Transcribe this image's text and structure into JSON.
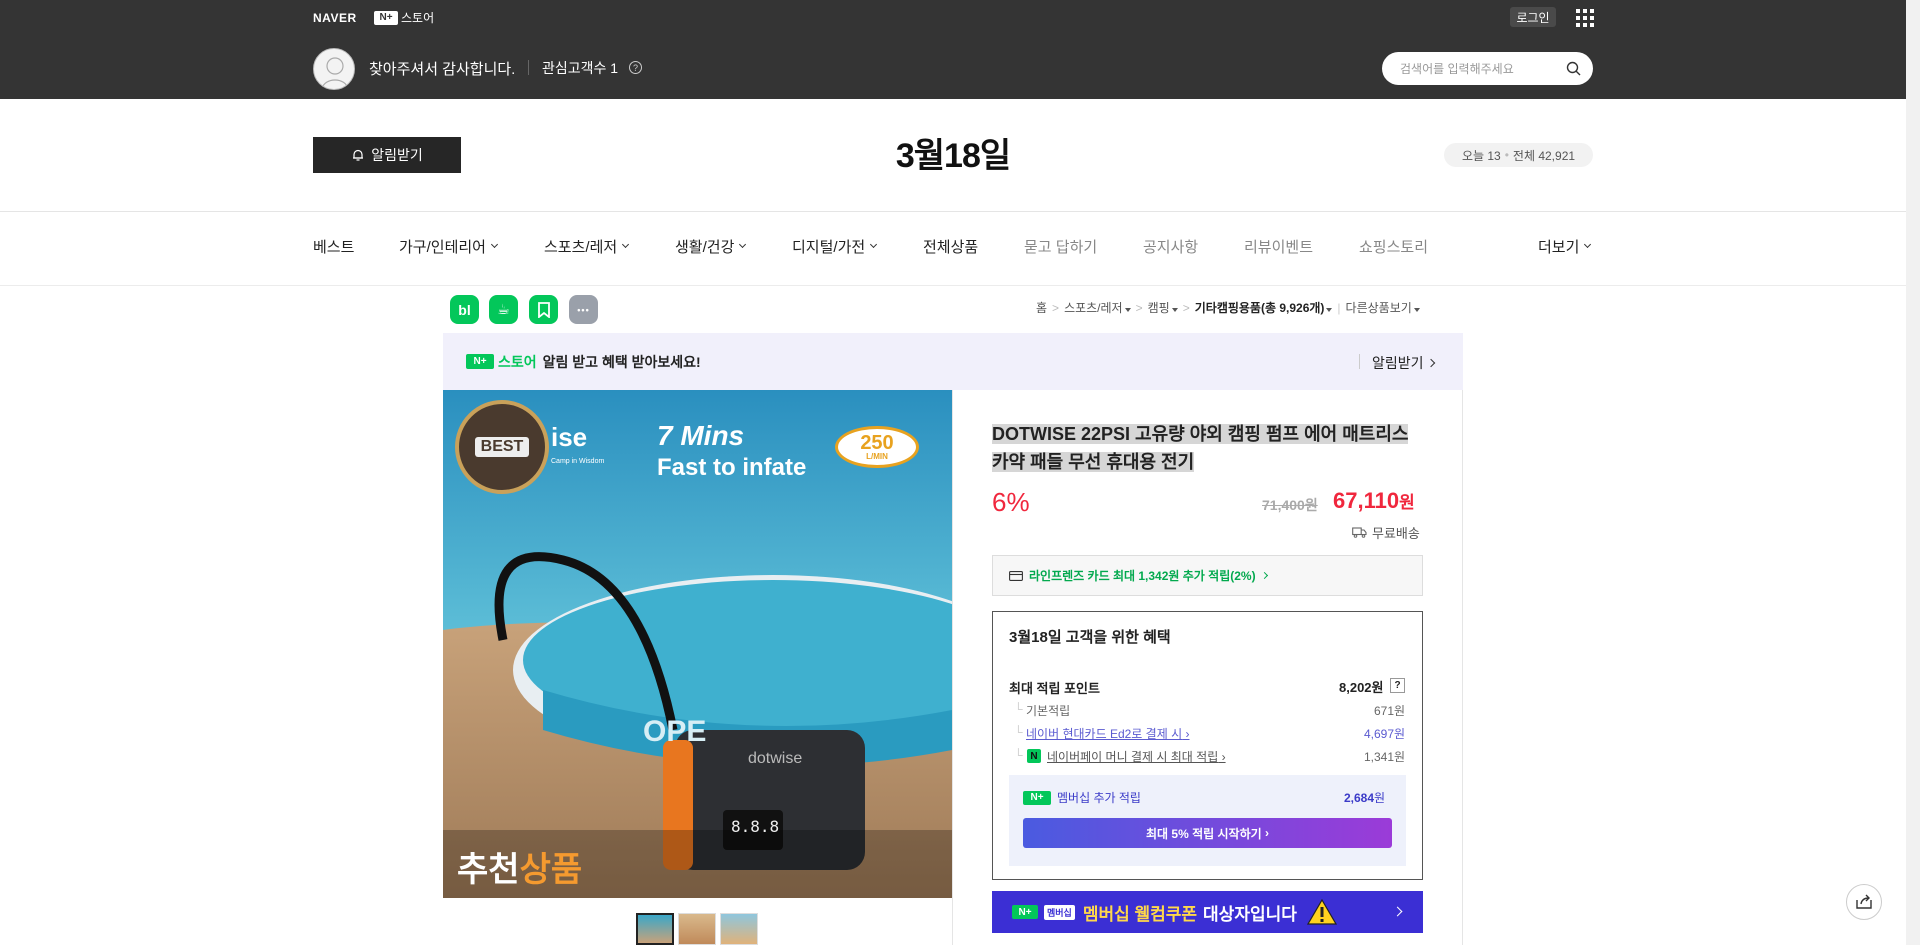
{
  "topbar": {
    "naver_logo": "NAVER",
    "nplus_badge": "N+",
    "store_label": "스토어",
    "login_label": "로그인",
    "welcome_text": "찾아주셔서 감사합니다.",
    "fans_label": "관심고객수 1",
    "info_icon_text": "?",
    "search_placeholder": "검색어를 입력해주세요"
  },
  "header": {
    "alarm_button_label": "알림받기",
    "store_title": "3월18일",
    "visitors_today": "오늘 13",
    "visitors_dot": "•",
    "visitors_total": "전체 42,921"
  },
  "nav": {
    "items": [
      {
        "label": "베스트"
      },
      {
        "label": "가구/인테리어"
      },
      {
        "label": "스포츠/레저"
      },
      {
        "label": "생활/건강"
      },
      {
        "label": "디지털/가전"
      },
      {
        "label": "전체상품"
      },
      {
        "label": "묻고 답하기"
      },
      {
        "label": "공지사항"
      },
      {
        "label": "리뷰이벤트"
      },
      {
        "label": "쇼핑스토리"
      },
      {
        "label": "더보기"
      }
    ]
  },
  "share_icons": {
    "blog": "bl",
    "cafe": "☕",
    "keep": "⌗",
    "more": "•••"
  },
  "breadcrumb": {
    "home": "홈",
    "sep": ">",
    "level1": "스포츠/레저",
    "level2": "캠핑",
    "level3": "기타캠핑용품(총 9,926개)",
    "other": "다른상품보기"
  },
  "promo": {
    "nbadge": "N+",
    "store": "스토어",
    "message": "알림 받고 혜택 받아보세요!",
    "action": "알림받기"
  },
  "product_image": {
    "best_badge": "BEST",
    "best_sub": "Camp in Wisdom",
    "brand_partial": "ise",
    "headline1": "7 Mins",
    "headline2": "Fast to infate",
    "flow_value": "250",
    "flow_unit": "L/MIN",
    "device_brand": "dotwise",
    "display_value": "8.8.8",
    "board_text": "OPE",
    "banner_white": "추천",
    "banner_orange": "상품"
  },
  "product": {
    "title": "DOTWISE 22PSI 고유량 야외 캠핑 펌프 에어 매트리스 카약 패들 무선 휴대용 전기",
    "discount": "6%",
    "original_price": "71,400원",
    "price": "67,110",
    "price_unit": "원",
    "shipping": "무료배송",
    "card_benefit": "라인프렌즈 카드 최대 1,342원 추가 적립(2%)"
  },
  "benefit": {
    "title": "3월18일 고객을 위한 혜택",
    "max_points_label": "최대 적립 포인트",
    "max_points_value": "8,202원",
    "help": "?",
    "rows": [
      {
        "label": "기본적립",
        "value": "671원"
      },
      {
        "label": "네이버 현대카드 Ed2로 결제 시",
        "value": "4,697원"
      },
      {
        "label": "네이버페이 머니 결제 시 최대 적립",
        "value": "1,341원"
      }
    ],
    "npay_icon": "N",
    "membership_badge": "N+",
    "membership_label": "멤버십 추가 적립",
    "membership_value": "2,684",
    "membership_unit": "원",
    "membership_button": "최대 5% 적립 시작하기"
  },
  "coupon": {
    "badge": "N+",
    "badge_sub": "멤버십",
    "yellow_text": "멤버십 웰컴쿠폰",
    "white_text": "대상자입니다"
  },
  "colors": {
    "topbar": "#343434",
    "naver_green": "#03c75a",
    "price_red": "#f0273d",
    "coupon_blue": "#3b2fd4"
  }
}
